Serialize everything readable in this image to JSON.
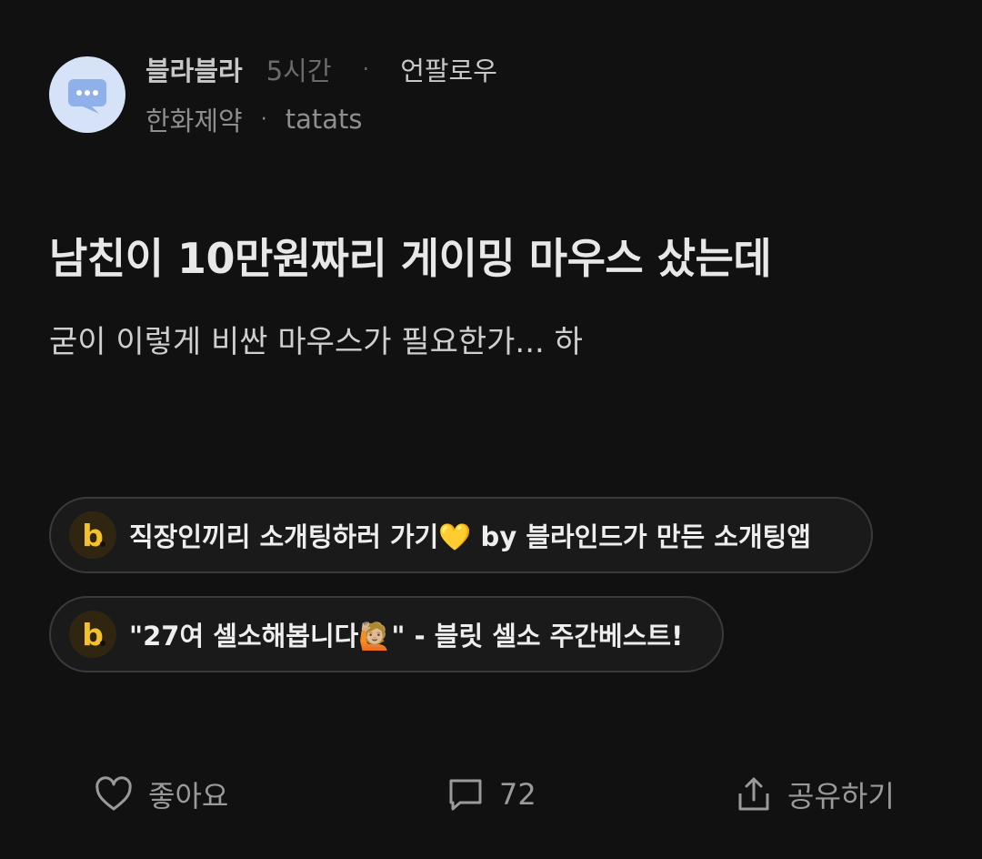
{
  "post": {
    "author": "블라블라",
    "time": "5시간",
    "separator": "·",
    "unfollow_label": "언팔로우",
    "company": "한화제약",
    "company_separator": "·",
    "nickname": "tatats",
    "title": "남친이 10만원짜리 게이밍 마우스 샀는데",
    "body": "굳이 이렇게 비싼 마우스가 필요한가... 하"
  },
  "promos": [
    {
      "logo": "b",
      "text": "직장인끼리 소개팅하러 가기💛 by 블라인드가 만든 소개팅앱"
    },
    {
      "logo": "b",
      "text": "\"27여 셀소해봅니다🙋🏼\" - 블릿 셀소 주간베스트!"
    }
  ],
  "actions": {
    "like_label": "좋아요",
    "comment_count": "72",
    "share_label": "공유하기"
  },
  "colors": {
    "background": "#111111",
    "avatar_bg": "#d5e2f7",
    "avatar_icon": "#8fb0ea",
    "promo_border": "#3a3a3a",
    "logo_accent": "#f5c02e"
  },
  "icons": [
    "chat-bubble-icon",
    "heart-icon",
    "comment-icon",
    "share-icon"
  ]
}
